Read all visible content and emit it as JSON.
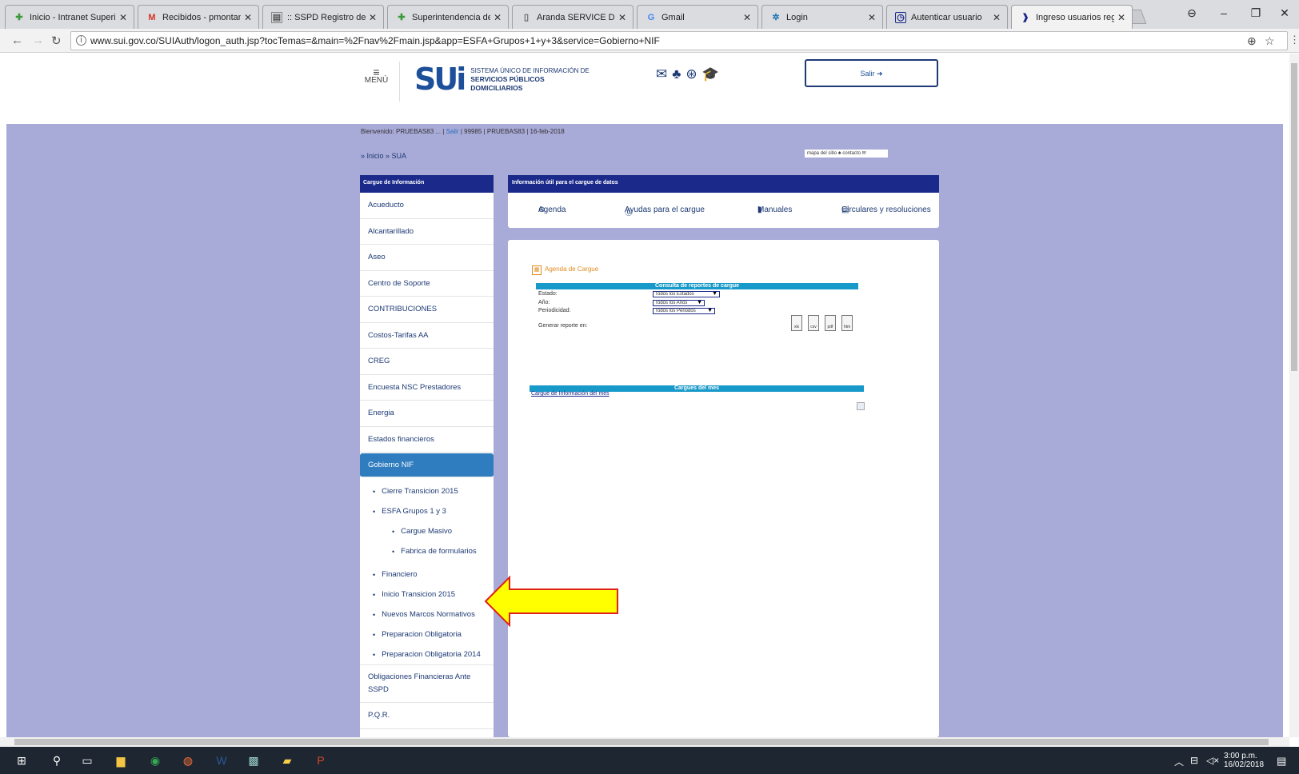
{
  "browser": {
    "tabs": [
      {
        "title": "Inicio - Intranet Superin",
        "icon": "supersalud-favicon"
      },
      {
        "title": "Recibidos - pmontana@",
        "icon": "gmail-m-icon"
      },
      {
        "title": ":: SSPD Registro de Ent",
        "icon": "document-favicon"
      },
      {
        "title": "Superintendencia de Se",
        "icon": "supersalud-favicon"
      },
      {
        "title": "Aranda SERVICE DESK ®",
        "icon": "page-icon"
      },
      {
        "title": "Gmail",
        "icon": "google-g-icon"
      },
      {
        "title": "Login",
        "icon": "login-favicon"
      },
      {
        "title": "Autenticar usuario",
        "icon": "clock-favicon"
      },
      {
        "title": "Ingreso usuarios regist",
        "icon": "sui-favicon"
      }
    ],
    "active_tab_index": 8,
    "url": "www.sui.gov.co/SUIAuth/logon_auth.jsp?tocTemas=&main=%2Fnav%2Fmain.jsp&app=ESFA+Grupos+1+y+3&service=Gobierno+NIF"
  },
  "header": {
    "menu_label": "MENÚ",
    "logo_mark": "SUi",
    "logo_line1": "SISTEMA ÚNICO DE INFORMACIÓN DE",
    "logo_line2": "SERVICIOS PÚBLICOS DOMICILIARIOS",
    "salir_label": "Salir"
  },
  "welcome": {
    "prefix": "Bienvenido: PRUEBAS83 ... | ",
    "salir": "Salir",
    "suffix": " | 99985 | PRUEBAS83 | 16-feb-2018"
  },
  "breadcrumb": {
    "home": "» Inicio",
    "current": "» SUA"
  },
  "site_tools": {
    "map": "mapa del sitio",
    "contact": "contacto"
  },
  "sidebar": {
    "title": "Cargue de Información",
    "items": [
      "Acueducto",
      "Alcantarillado",
      "Aseo",
      "Centro de Soporte",
      "CONTRIBUCIONES",
      "Costos-Tarifas AA",
      "CREG",
      "Encuesta NSC Prestadores",
      "Energia",
      "Estados financieros"
    ],
    "selected": "Gobierno NIF",
    "sub_items": [
      "Cierre Transicion 2015",
      "ESFA Grupos 1 y 3"
    ],
    "deep_items": [
      "Cargue Masivo",
      "Fabrica de formularios"
    ],
    "sub_items_2": [
      "Financiero",
      "Inicio Transicion 2015",
      "Nuevos Marcos Normativos",
      "Preparacion Obligatoria",
      "Preparacion Obligatoria 2014"
    ],
    "tail_items": [
      "Obligaciones Financieras Ante SSPD",
      "P.Q.R."
    ]
  },
  "info_panel": {
    "title": "Información útil para el cargue de datos",
    "links": [
      "Agenda",
      "Ayudas para el cargue",
      "Manuales",
      "Circulares y resoluciones"
    ]
  },
  "agenda": {
    "title": "Agenda de Cargue",
    "report_bar": "Consulta de reportes de cargue",
    "estado_label": "Estado:",
    "estado_value": "Todos los Estados",
    "anio_label": "Año:",
    "anio_value": "Todos los Años",
    "periodicidad_label": "Periodicidad:",
    "periodicidad_value": "Todos los Periodos",
    "generar_label": "Generar reporte en:",
    "formats": [
      "xls",
      "csv",
      "pdf",
      "htm"
    ],
    "month_bar": "Cargues del mes",
    "month_link": "Cargue de Información del mes"
  },
  "taskbar": {
    "time": "3:00 p.m.",
    "date": "16/02/2018"
  },
  "colors": {
    "band": "#a8aad7",
    "nav_header": "#1b2a8a",
    "selected_item": "#2f7cbe",
    "cyan_bar": "#1799c9",
    "arrow_fill": "#ffff00",
    "arrow_stroke": "#e0201a"
  }
}
